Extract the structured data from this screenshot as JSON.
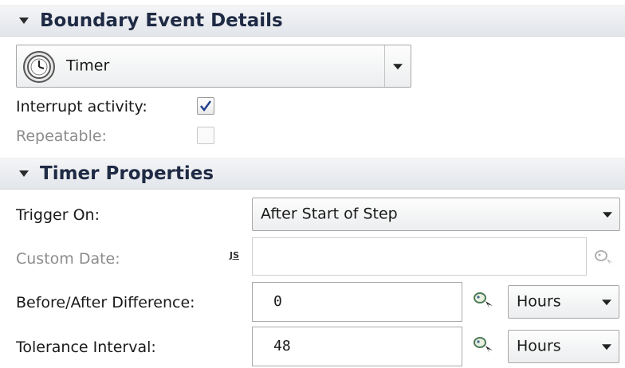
{
  "boundary_section": {
    "title": "Boundary Event Details",
    "event_type": {
      "value": "Timer",
      "icon": "timer-clock-icon"
    },
    "interrupt_activity": {
      "label": "Interrupt activity:",
      "checked": true
    },
    "repeatable": {
      "label": "Repeatable:",
      "checked": false,
      "enabled": false
    }
  },
  "timer_section": {
    "title": "Timer Properties",
    "trigger_on": {
      "label": "Trigger On:",
      "value": "After Start of Step"
    },
    "custom_date": {
      "label": "Custom Date:",
      "value": "",
      "enabled": false,
      "js_marker": "JS"
    },
    "before_after_difference": {
      "label": "Before/After Difference:",
      "value": "0",
      "unit": "Hours"
    },
    "tolerance_interval": {
      "label": "Tolerance Interval:",
      "value": "48",
      "unit": "Hours"
    }
  }
}
